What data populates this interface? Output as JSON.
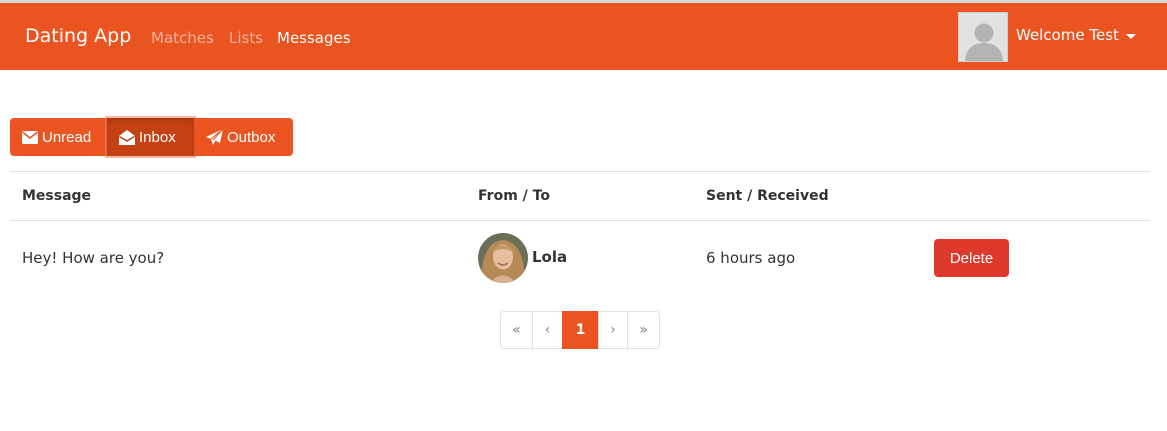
{
  "navbar": {
    "brand": "Dating App",
    "links": [
      "Matches",
      "Lists",
      "Messages"
    ],
    "active_link": "Messages",
    "welcome": "Welcome Test",
    "accent_color": "#e95420"
  },
  "message_tabs": {
    "buttons": [
      {
        "label": "Unread",
        "icon": "envelope-icon"
      },
      {
        "label": "Inbox",
        "icon": "envelope-open-icon"
      },
      {
        "label": "Outbox",
        "icon": "paper-plane-icon"
      }
    ],
    "active": "Inbox"
  },
  "table": {
    "headers": [
      "Message",
      "From / To",
      "Sent / Received"
    ],
    "rows": [
      {
        "message": "Hey! How are you?",
        "from": "Lola",
        "sent": "6 hours ago",
        "action": "Delete"
      }
    ]
  },
  "pagination": {
    "first": "«",
    "prev": "‹",
    "pages": [
      "1"
    ],
    "current_page": "1",
    "next": "›",
    "last": "»"
  },
  "colors": {
    "primary": "#e95420",
    "danger": "#df382c"
  }
}
